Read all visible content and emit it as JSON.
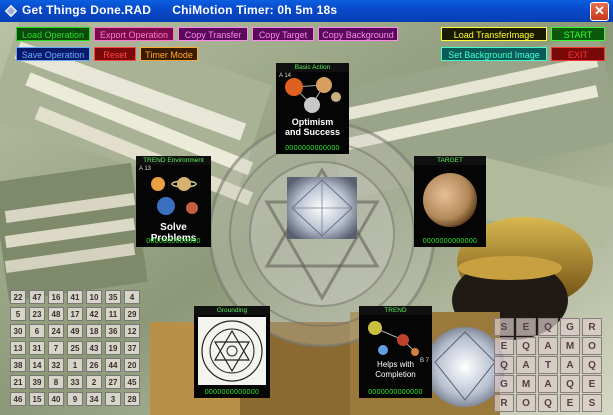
{
  "window": {
    "app_title": "Get Things Done.RAD",
    "timer_label": "ChiMotion Timer:",
    "timer_value": "0h 5m 18s",
    "close_glyph": "✕"
  },
  "toolbar": {
    "row1": [
      {
        "label": "Load Operation",
        "color": "#22dd22",
        "bg": "#0b4a0b"
      },
      {
        "label": "Export Operation",
        "color": "#ff77cc",
        "bg": "#7a0a4a"
      },
      {
        "label": "Copy Transfer",
        "color": "#ff88ee",
        "bg": "#5a0a5a"
      },
      {
        "label": "Copy Target",
        "color": "#ff88ee",
        "bg": "#5a0a5a"
      },
      {
        "label": "Copy Background",
        "color": "#ff88ee",
        "bg": "#5a0a5a"
      },
      {
        "label": "Load TransferImage",
        "color": "#ffff33",
        "bg": "#1a1a00"
      },
      {
        "label": "START",
        "color": "#33ff33",
        "bg": "#0b5a0b"
      }
    ],
    "row2": [
      {
        "label": "Save Operation",
        "color": "#66aaff",
        "bg": "#0a1a6a"
      },
      {
        "label": "Reset",
        "color": "#ff4444",
        "bg": "#7a0a0a"
      },
      {
        "label": "Timer Mode",
        "color": "#ffaa33",
        "bg": "#3a1a00"
      },
      {
        "label": "Set Background Image",
        "color": "#44ffcc",
        "bg": "#0a5a5a"
      },
      {
        "label": "EXIT",
        "color": "#ff3333",
        "bg": "#7a0a0a"
      }
    ]
  },
  "tiles": {
    "basic_action": {
      "label": "Basic Action",
      "num": "A 14",
      "line1": "Optimism",
      "line2": "and Success",
      "code": "0000000000000"
    },
    "trend_environment": {
      "label": "TREND Environment",
      "num": "A 13",
      "caption": "Solve Problems",
      "code": "0000000000000"
    },
    "target": {
      "label": "TARGET",
      "code": "0000000000000"
    },
    "grounding": {
      "label": "Grounding",
      "code": "0000000000000"
    },
    "trend": {
      "label": "TREND",
      "num": "B 7",
      "line1": "Helps with",
      "line2": "Completion",
      "code": "0000000000000"
    }
  },
  "left_grid": [
    [
      "22",
      "47",
      "16",
      "41",
      "10",
      "35",
      "4"
    ],
    [
      "5",
      "23",
      "48",
      "17",
      "42",
      "11",
      "29"
    ],
    [
      "30",
      "6",
      "24",
      "49",
      "18",
      "36",
      "12"
    ],
    [
      "13",
      "31",
      "7",
      "25",
      "43",
      "19",
      "37"
    ],
    [
      "38",
      "14",
      "32",
      "1",
      "26",
      "44",
      "20"
    ],
    [
      "21",
      "39",
      "8",
      "33",
      "2",
      "27",
      "45"
    ],
    [
      "46",
      "15",
      "40",
      "9",
      "34",
      "3",
      "28"
    ]
  ],
  "right_grid": [
    [
      "S",
      "E",
      "Q",
      "G",
      "R"
    ],
    [
      "E",
      "Q",
      "A",
      "M",
      "O"
    ],
    [
      "Q",
      "A",
      "T",
      "A",
      "Q"
    ],
    [
      "G",
      "M",
      "A",
      "Q",
      "E"
    ],
    [
      "R",
      "O",
      "Q",
      "E",
      "S"
    ]
  ]
}
